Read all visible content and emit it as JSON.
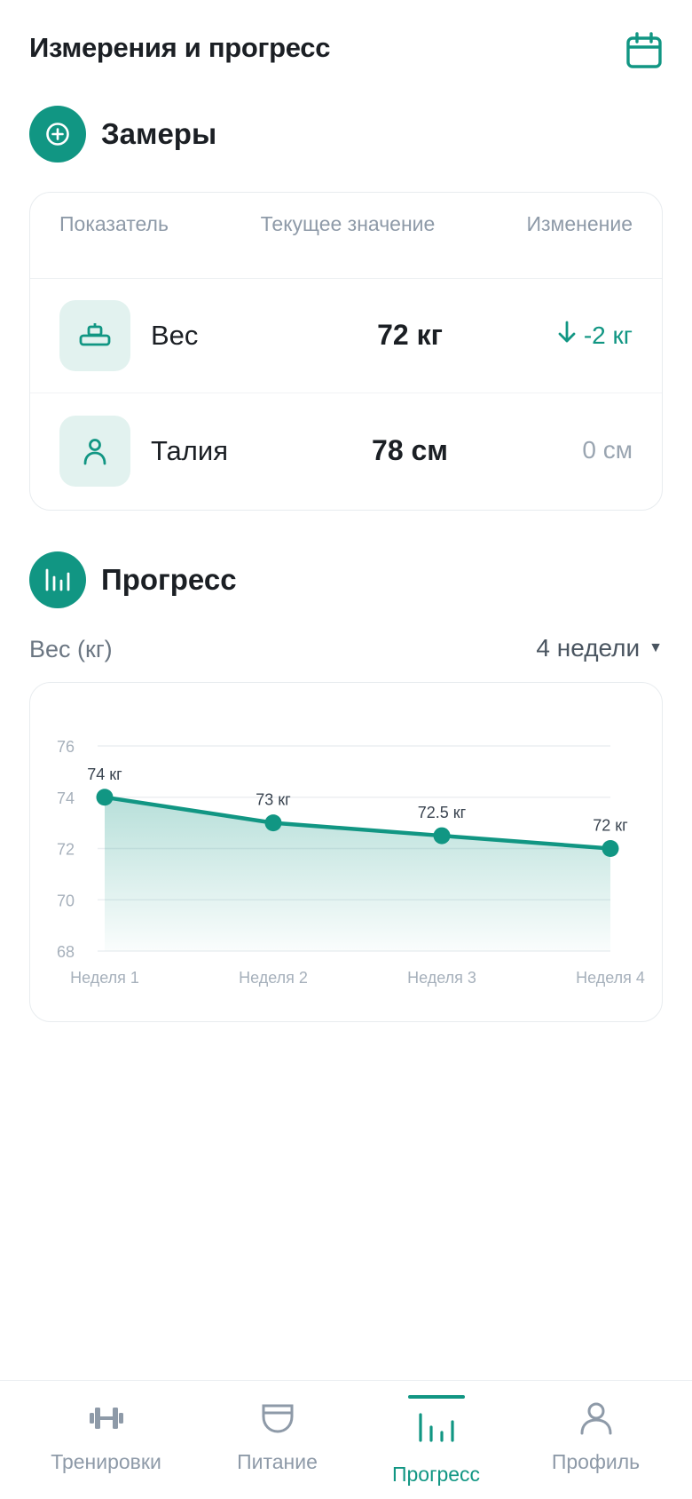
{
  "header": {
    "title": "Измерения и прогресс",
    "calendar_icon": "calendar-icon"
  },
  "measurements": {
    "title": "Замеры",
    "add_icon": "plus-circle-icon",
    "columns": {
      "name": "Показатель",
      "value": "Текущее значение",
      "change": "Изменение"
    },
    "rows": [
      {
        "icon": "scale-icon",
        "label": "Вес",
        "value": "72 кг",
        "change": "-2 кг",
        "direction": "down"
      },
      {
        "icon": "person-icon",
        "label": "Талия",
        "value": "78 см",
        "change": "0 см",
        "direction": "none"
      }
    ]
  },
  "progress": {
    "title": "Прогресс",
    "icon": "bar-chart-icon",
    "metric_label": "Вес (кг)",
    "period": "4 недели"
  },
  "chart_data": {
    "type": "area",
    "categories": [
      "Неделя 1",
      "Неделя 2",
      "Неделя 3",
      "Неделя 4"
    ],
    "values": [
      74,
      73,
      72.5,
      72
    ],
    "data_labels": [
      "74 кг",
      "73 кг",
      "72.5 кг",
      "72 кг"
    ],
    "ylim": [
      68,
      76
    ],
    "yticks": [
      76,
      74,
      72,
      70,
      68
    ],
    "grid": true,
    "color": "#119683"
  },
  "nav": {
    "items": [
      {
        "label": "Тренировки",
        "icon": "dumbbell-icon",
        "active": false
      },
      {
        "label": "Питание",
        "icon": "bowl-icon",
        "active": false
      },
      {
        "label": "Прогресс",
        "icon": "bar-chart-icon",
        "active": true
      },
      {
        "label": "Профиль",
        "icon": "user-icon",
        "active": false
      }
    ]
  },
  "colors": {
    "accent": "#119683",
    "accent_light": "#e2f2ef",
    "muted": "#8e9aa8"
  }
}
